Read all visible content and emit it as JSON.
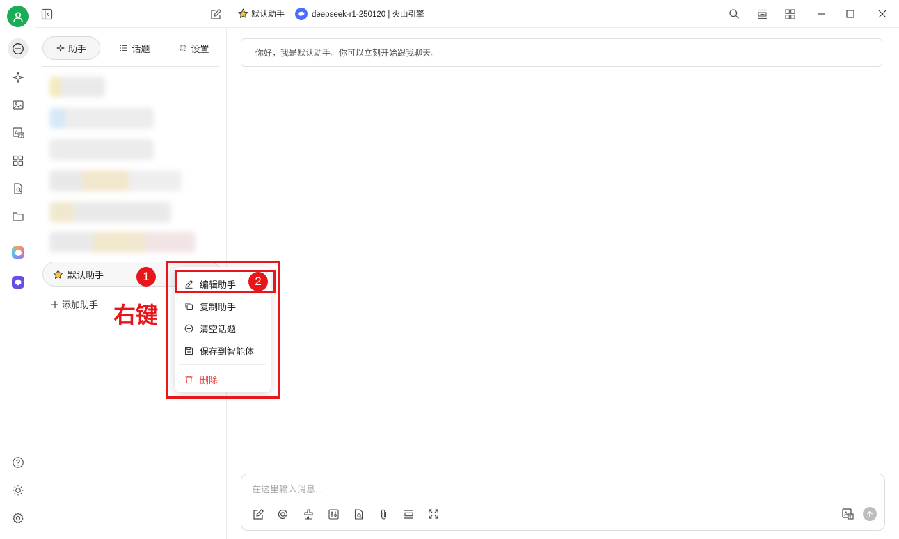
{
  "topbar": {
    "assistant_name": "默认助手",
    "model_label": "deepseek-r1-250120 | 火山引擎"
  },
  "panel": {
    "tabs": [
      {
        "label": "助手",
        "icon": "sparkle-icon"
      },
      {
        "label": "话题",
        "icon": "list-icon"
      },
      {
        "label": "设置",
        "icon": "gear-icon"
      }
    ],
    "current_assistant": "默认助手",
    "add_assistant": "添加助手"
  },
  "context_menu": {
    "items": [
      {
        "label": "编辑助手",
        "icon": "edit-icon"
      },
      {
        "label": "复制助手",
        "icon": "copy-icon"
      },
      {
        "label": "清空话题",
        "icon": "minus-circle-icon"
      },
      {
        "label": "保存到智能体",
        "icon": "save-icon"
      },
      {
        "label": "删除",
        "icon": "trash-icon"
      }
    ]
  },
  "annotations": {
    "step1": "1",
    "step2": "2",
    "right_click_label": "右键"
  },
  "chat": {
    "welcome": "你好，我是默认助手。你可以立刻开始跟我聊天。",
    "input_placeholder": "在这里输入消息..."
  },
  "colors": {
    "accent_green": "#1aad55",
    "annotation_red": "#e8151b",
    "danger": "#e0433e"
  }
}
